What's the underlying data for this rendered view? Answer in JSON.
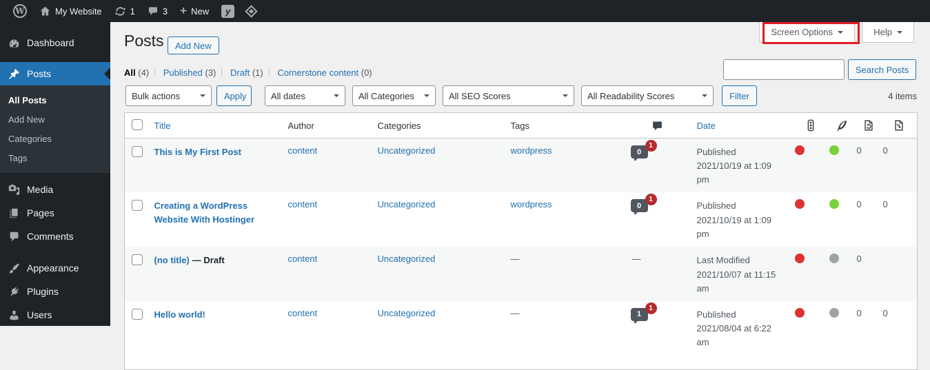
{
  "admin_bar": {
    "site_name": "My Website",
    "updates_count": "1",
    "comments_count": "3",
    "new_label": "New",
    "wp_logo_letter": "W",
    "yoast_letter": "y"
  },
  "sidebar": {
    "items": [
      {
        "label": "Dashboard"
      },
      {
        "label": "Posts"
      },
      {
        "label": "Media"
      },
      {
        "label": "Pages"
      },
      {
        "label": "Comments"
      },
      {
        "label": "Appearance"
      },
      {
        "label": "Plugins"
      },
      {
        "label": "Users"
      }
    ],
    "posts_submenu": [
      {
        "label": "All Posts",
        "current": true
      },
      {
        "label": "Add New"
      },
      {
        "label": "Categories"
      },
      {
        "label": "Tags"
      }
    ]
  },
  "screen_meta": {
    "screen_options_label": "Screen Options",
    "help_label": "Help"
  },
  "page": {
    "title": "Posts",
    "add_new_label": "Add New"
  },
  "views": [
    {
      "label": "All",
      "count": "(4)"
    },
    {
      "label": "Published",
      "count": "(3)"
    },
    {
      "label": "Draft",
      "count": "(1)"
    },
    {
      "label": "Cornerstone content",
      "count": "(0)"
    }
  ],
  "search": {
    "value": "",
    "button_label": "Search Posts"
  },
  "filters": {
    "bulk_actions": "Bulk actions",
    "apply_label": "Apply",
    "all_dates": "All dates",
    "all_categories": "All Categories",
    "all_seo_scores": "All SEO Scores",
    "all_readability_scores": "All Readability Scores",
    "filter_label": "Filter",
    "items_count": "4 items"
  },
  "table": {
    "headers": {
      "title": "Title",
      "author": "Author",
      "categories": "Categories",
      "tags": "Tags",
      "date": "Date"
    },
    "rows": [
      {
        "title": "This is My First Post",
        "title_suffix": "",
        "author": "content",
        "categories": "Uncategorized",
        "tags": "wordpress",
        "comments": "0",
        "comment_badge": "1",
        "date_line1": "Published",
        "date_line2": "2021/10/19 at 1:09 pm",
        "seo": "red",
        "readability": "green",
        "outbound_links": "0",
        "inbound_links": "0"
      },
      {
        "title": "Creating a WordPress Website With Hostinger",
        "title_suffix": "",
        "author": "content",
        "categories": "Uncategorized",
        "tags": "wordpress",
        "comments": "0",
        "comment_badge": "1",
        "date_line1": "Published",
        "date_line2": "2021/10/19 at 1:09 pm",
        "seo": "red",
        "readability": "green",
        "outbound_links": "0",
        "inbound_links": "0"
      },
      {
        "title": "(no title)",
        "title_suffix": "— Draft",
        "author": "content",
        "categories": "Uncategorized",
        "tags": "—",
        "comments": "—",
        "comment_badge": "",
        "date_line1": "Last Modified",
        "date_line2": "2021/10/07 at 11:15 am",
        "seo": "red",
        "readability": "gray",
        "outbound_links": "0",
        "inbound_links": ""
      },
      {
        "title": "Hello world!",
        "title_suffix": "",
        "author": "content",
        "categories": "Uncategorized",
        "tags": "—",
        "comments": "1",
        "comment_badge": "1",
        "date_line1": "Published",
        "date_line2": "2021/08/04 at 6:22 am",
        "seo": "red",
        "readability": "gray",
        "outbound_links": "0",
        "inbound_links": "0"
      }
    ]
  },
  "colors": {
    "accent_blue": "#2271b1",
    "admin_dark": "#1d2327",
    "submenu_dark": "#2c3338",
    "seo_bad_red": "#dc3232",
    "seo_good_green": "#7ad03a",
    "score_na_gray": "#9ea3a8",
    "comment_bubble": "#50575e",
    "comment_badge_red": "#b32d2e",
    "highlight_box_red": "#e01b22",
    "alt_row": "#f6f7f7"
  }
}
